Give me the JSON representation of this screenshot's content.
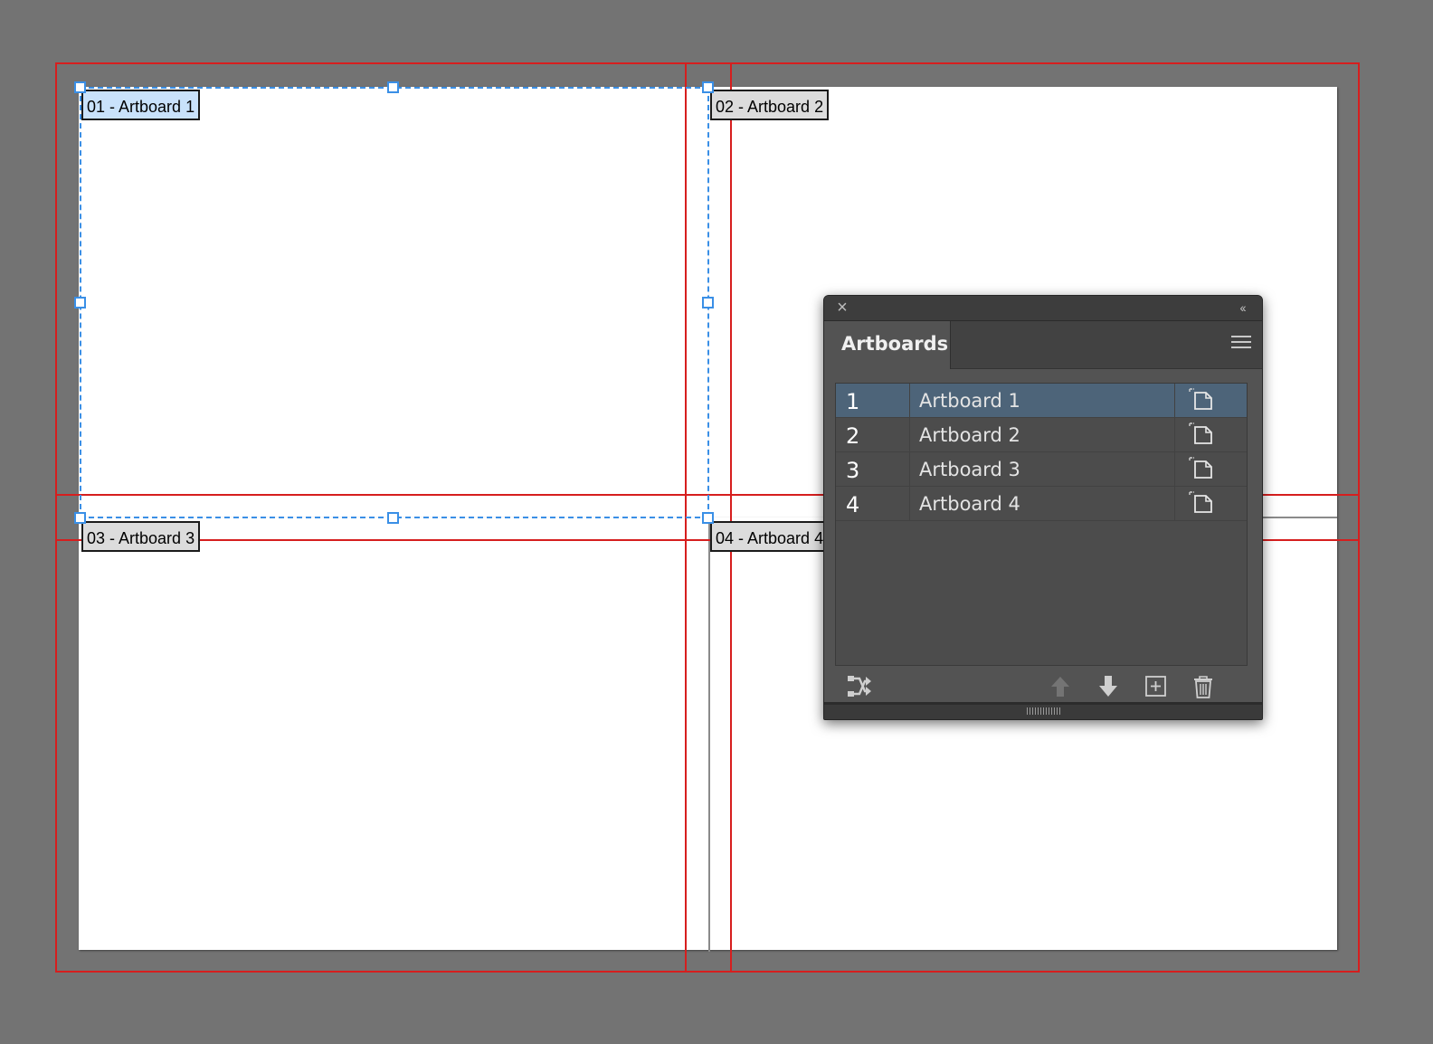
{
  "canvas": {
    "artboards": [
      {
        "id": "artboard-1",
        "label": "01 - Artboard 1",
        "active": true
      },
      {
        "id": "artboard-2",
        "label": "02 - Artboard 2",
        "active": false
      },
      {
        "id": "artboard-3",
        "label": "03 - Artboard 3",
        "active": false
      },
      {
        "id": "artboard-4",
        "label": "04 - Artboard 4",
        "active": false
      }
    ]
  },
  "panel": {
    "close_icon": "×",
    "collapse_icon": "‹‹",
    "tab_label": "Artboards",
    "rows": [
      {
        "number": "1",
        "name": "Artboard 1",
        "selected": true
      },
      {
        "number": "2",
        "name": "Artboard 2",
        "selected": false
      },
      {
        "number": "3",
        "name": "Artboard 3",
        "selected": false
      },
      {
        "number": "4",
        "name": "Artboard 4",
        "selected": false
      }
    ],
    "footer_icons": [
      "rearrange-icon",
      "move-up-icon",
      "move-down-icon",
      "new-artboard-icon",
      "delete-icon"
    ]
  },
  "colors": {
    "canvas_bg": "#737373",
    "guide": "#d61e1e",
    "selection": "#3a8fe6",
    "panel_bg": "#535353",
    "row_selected": "#4d6479"
  }
}
